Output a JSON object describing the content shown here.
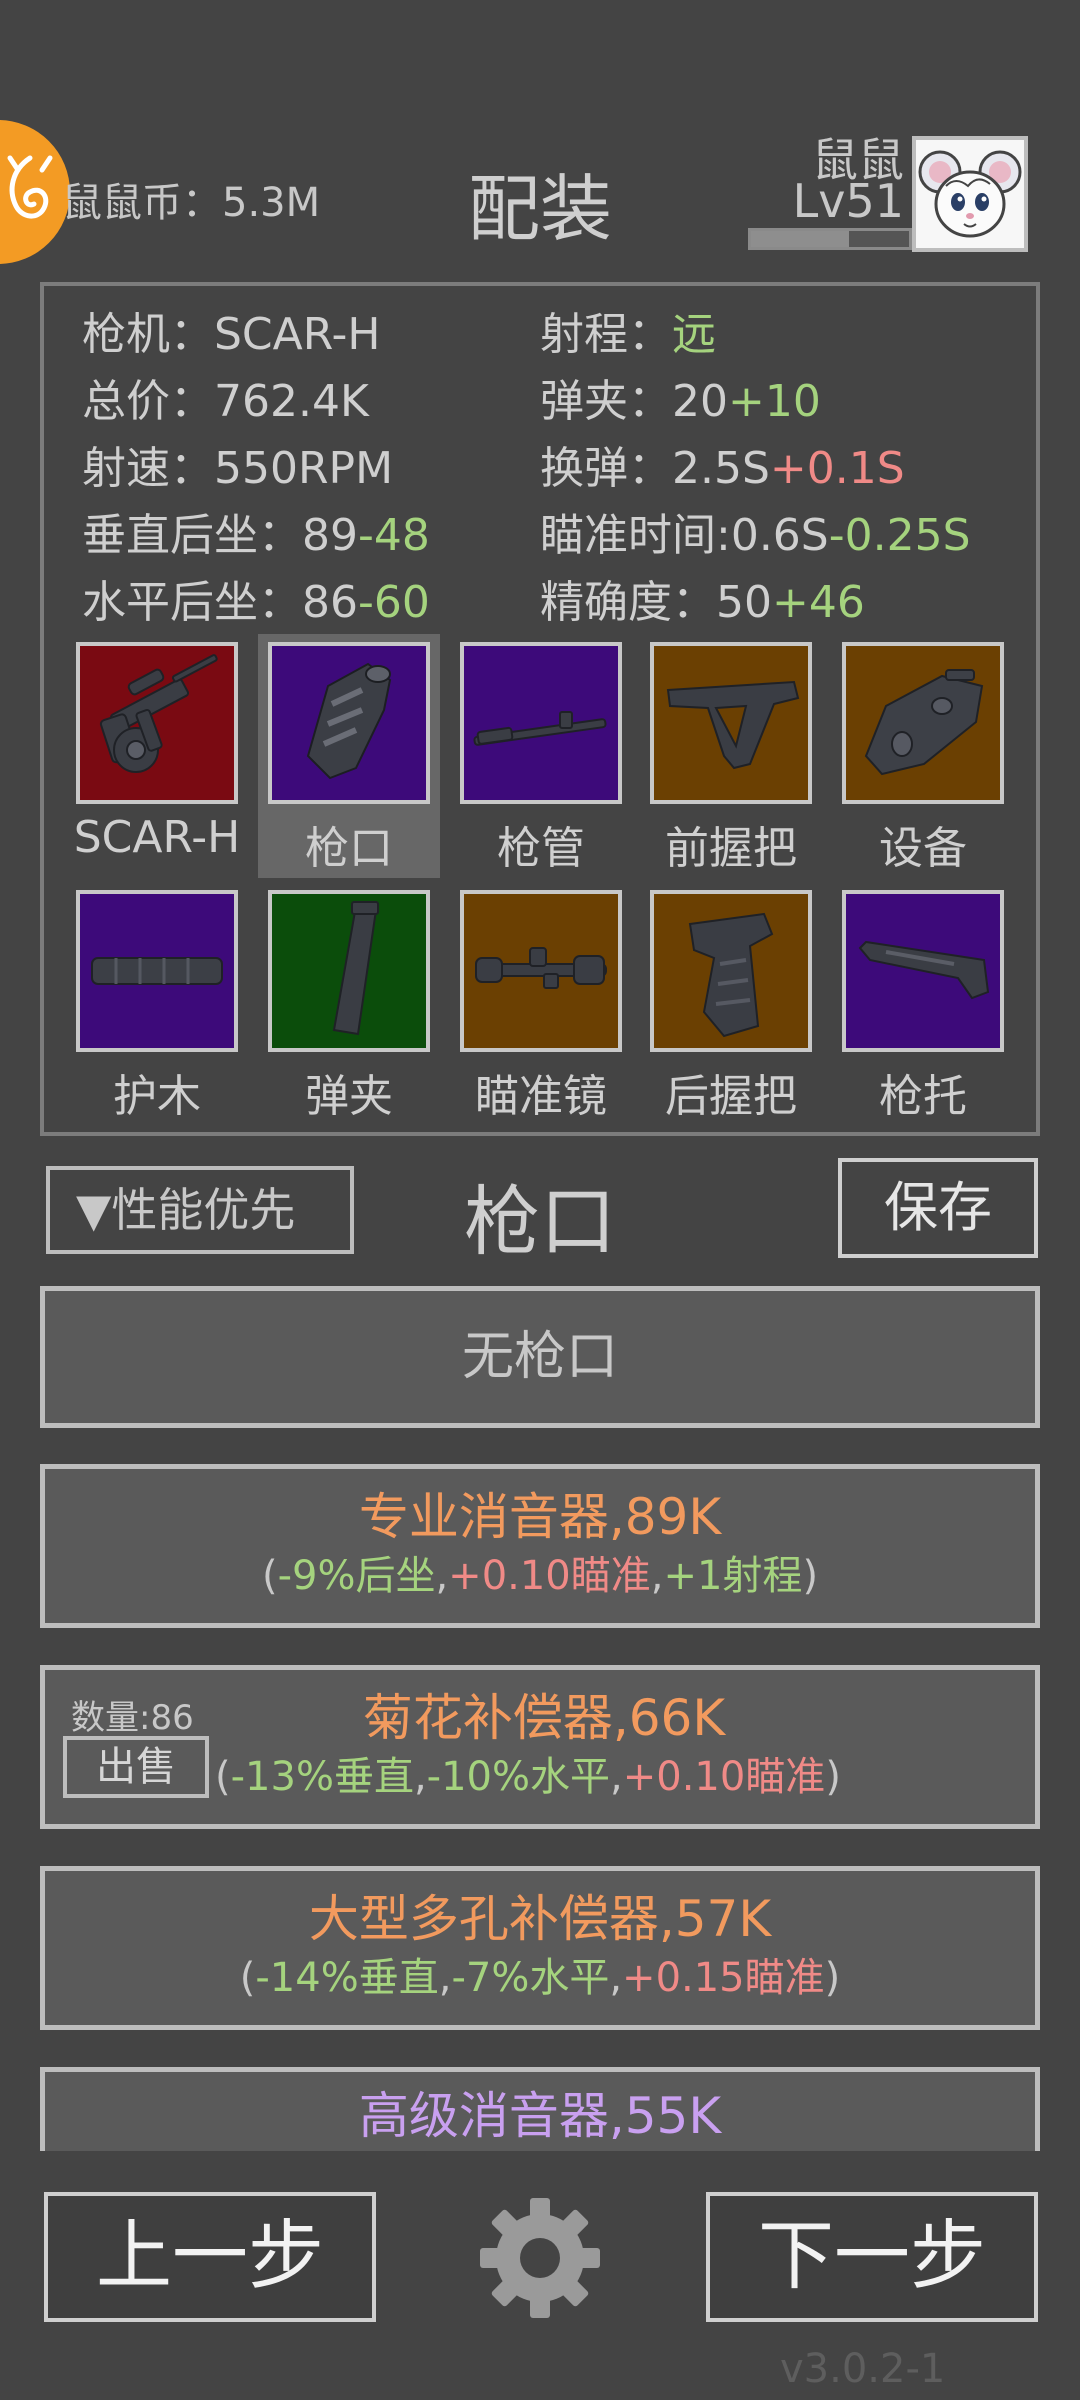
{
  "header": {
    "coin_text": "鼠鼠币：5.3M",
    "title": "配装",
    "player_name": "鼠鼠",
    "player_level": "Lv51",
    "xp_progress": 0.62
  },
  "stats": {
    "gun": "枪机：SCAR-H",
    "price": "总价：762.4K",
    "fire_rate": "射速：550RPM",
    "vertical_recoil": {
      "label": "垂直后坐：89",
      "delta": "-48"
    },
    "horizontal_recoil": {
      "label": "水平后坐：86",
      "delta": "-60"
    },
    "range": {
      "label": "射程：",
      "value": "远"
    },
    "magazine": {
      "label": "弹夹：20",
      "delta": "+10"
    },
    "reload": {
      "label": "换弹：2.5S",
      "delta": "+0.1S"
    },
    "aim_time": {
      "label": "瞄准时间:0.6S",
      "delta": "-0.25S"
    },
    "accuracy": {
      "label": "精确度：50",
      "delta": "+46"
    }
  },
  "slots": [
    {
      "label": "SCAR-H",
      "bg": "#7a0a12"
    },
    {
      "label": "枪口",
      "bg": "#3d0a7a"
    },
    {
      "label": "枪管",
      "bg": "#3d0a7a"
    },
    {
      "label": "前握把",
      "bg": "#6b4002"
    },
    {
      "label": "设备",
      "bg": "#6b4002"
    },
    {
      "label": "护木",
      "bg": "#3d0a7a"
    },
    {
      "label": "弹夹",
      "bg": "#0b4d0b"
    },
    {
      "label": "瞄准镜",
      "bg": "#6b4002"
    },
    {
      "label": "后握把",
      "bg": "#6b4002"
    },
    {
      "label": "枪托",
      "bg": "#3d0a7a"
    }
  ],
  "controls": {
    "sort_label": "▼性能优先",
    "section_title": "枪口",
    "save_label": "保存"
  },
  "items": {
    "none_label": "无枪口",
    "item1": {
      "name": "专业消音器,89K",
      "p1": "(",
      "e1": "-9%后坐",
      "s1": ",",
      "e2": "+0.10瞄准",
      "s2": ",",
      "e3": "+1射程",
      "p2": ")"
    },
    "item2": {
      "quantity": "数量:86",
      "sell_label": "出售",
      "name": "菊花补偿器,66K",
      "p1": "(",
      "e1": "-13%垂直",
      "s1": ",",
      "e2": "-10%水平",
      "s2": ",",
      "e3": "+0.10瞄准",
      "p2": ")"
    },
    "item3": {
      "name": "大型多孔补偿器,57K",
      "p1": "(",
      "e1": "-14%垂直",
      "s1": ",",
      "e2": "-7%水平",
      "s2": ",",
      "e3": "+0.15瞄准",
      "p2": ")"
    },
    "item4": {
      "name": "高级消音器,55K"
    }
  },
  "colors": {
    "item4_name": "#c9a0f0"
  },
  "footer": {
    "prev_label": "上一步",
    "next_label": "下一步",
    "version": "v3.0.2-1"
  }
}
